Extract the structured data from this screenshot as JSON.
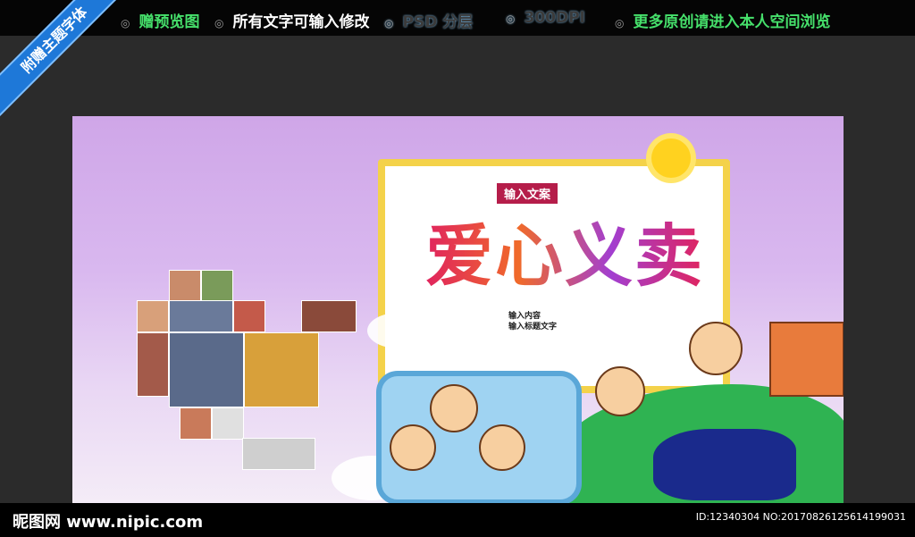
{
  "topbar": {
    "items": [
      {
        "label": "赠预览图",
        "style": "green"
      },
      {
        "label": "所有文字可输入修改",
        "style": "white"
      },
      {
        "label": "PSD 分层",
        "style": "faint"
      },
      {
        "label": "300DPI",
        "style": "faint"
      },
      {
        "label": "更多原创请进入本人空间浏览",
        "style": "green"
      }
    ]
  },
  "ribbon": {
    "label": "附赠主题字体"
  },
  "poster": {
    "tag": "输入文案",
    "title": "爱心义卖",
    "subtext_line1": "输入内容",
    "subtext_line2": "输入标题文字"
  },
  "footer": {
    "logo": "昵图网 www.nipic.com",
    "id": "ID:12340304 NO:20170826125614199031"
  },
  "colors": {
    "accent_green": "#46e06b",
    "ribbon_blue": "#1e78d8"
  }
}
